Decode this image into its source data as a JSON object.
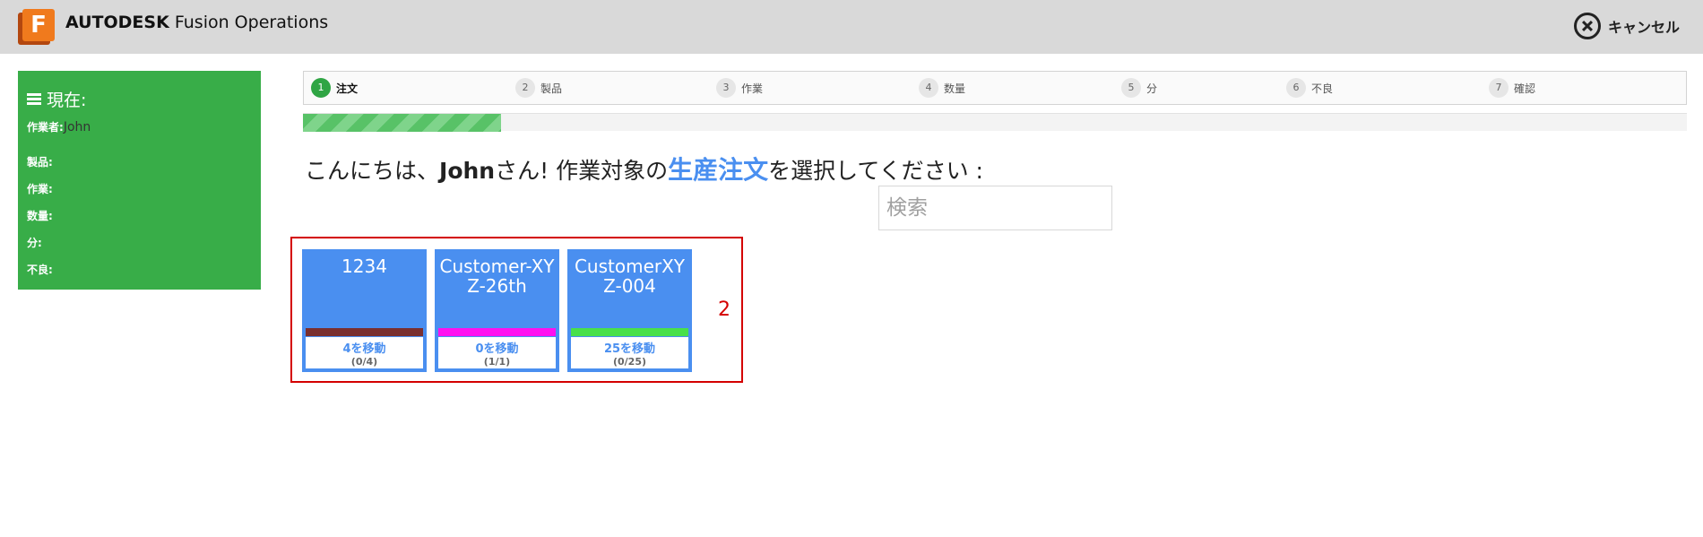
{
  "header": {
    "logo_letter": "F",
    "brand_bold": "AUTODESK",
    "brand_rest": " Fusion Operations",
    "cancel_label": "キャンセル"
  },
  "status": {
    "title": "現在:",
    "worker_label": "作業者:",
    "worker_value": "John",
    "product_label": "製品:",
    "task_label": "作業:",
    "quantity_label": "数量:",
    "minutes_label": "分:",
    "defect_label": "不良:"
  },
  "steps": [
    {
      "num": "1",
      "label": "注文"
    },
    {
      "num": "2",
      "label": "製品"
    },
    {
      "num": "3",
      "label": "作業"
    },
    {
      "num": "4",
      "label": "数量"
    },
    {
      "num": "5",
      "label": "分"
    },
    {
      "num": "6",
      "label": "不良"
    },
    {
      "num": "7",
      "label": "確認"
    }
  ],
  "progress": {
    "fraction": 0.143
  },
  "headline": {
    "pre": "こんにちは、",
    "name": "John",
    "mid": "さん! 作業対象の",
    "highlight": "生産注文",
    "post": "を選択してください :"
  },
  "search": {
    "placeholder": "検索"
  },
  "orders": {
    "count": "2",
    "cards": [
      {
        "title": "1234",
        "bar_color": "#7a2f2f",
        "move": "4を移動",
        "count": "(0/4)"
      },
      {
        "title": "Customer-XYZ-26th",
        "bar_color": "#ff10f0",
        "move": "0を移動",
        "count": "(1/1)"
      },
      {
        "title": "CustomerXYZ-004",
        "bar_color": "#48e04a",
        "move": "25を移動",
        "count": "(0/25)"
      }
    ]
  },
  "colors": {
    "accent": "#4a8ff0",
    "status_green": "#38ad48",
    "highlight_red": "#d40000"
  }
}
